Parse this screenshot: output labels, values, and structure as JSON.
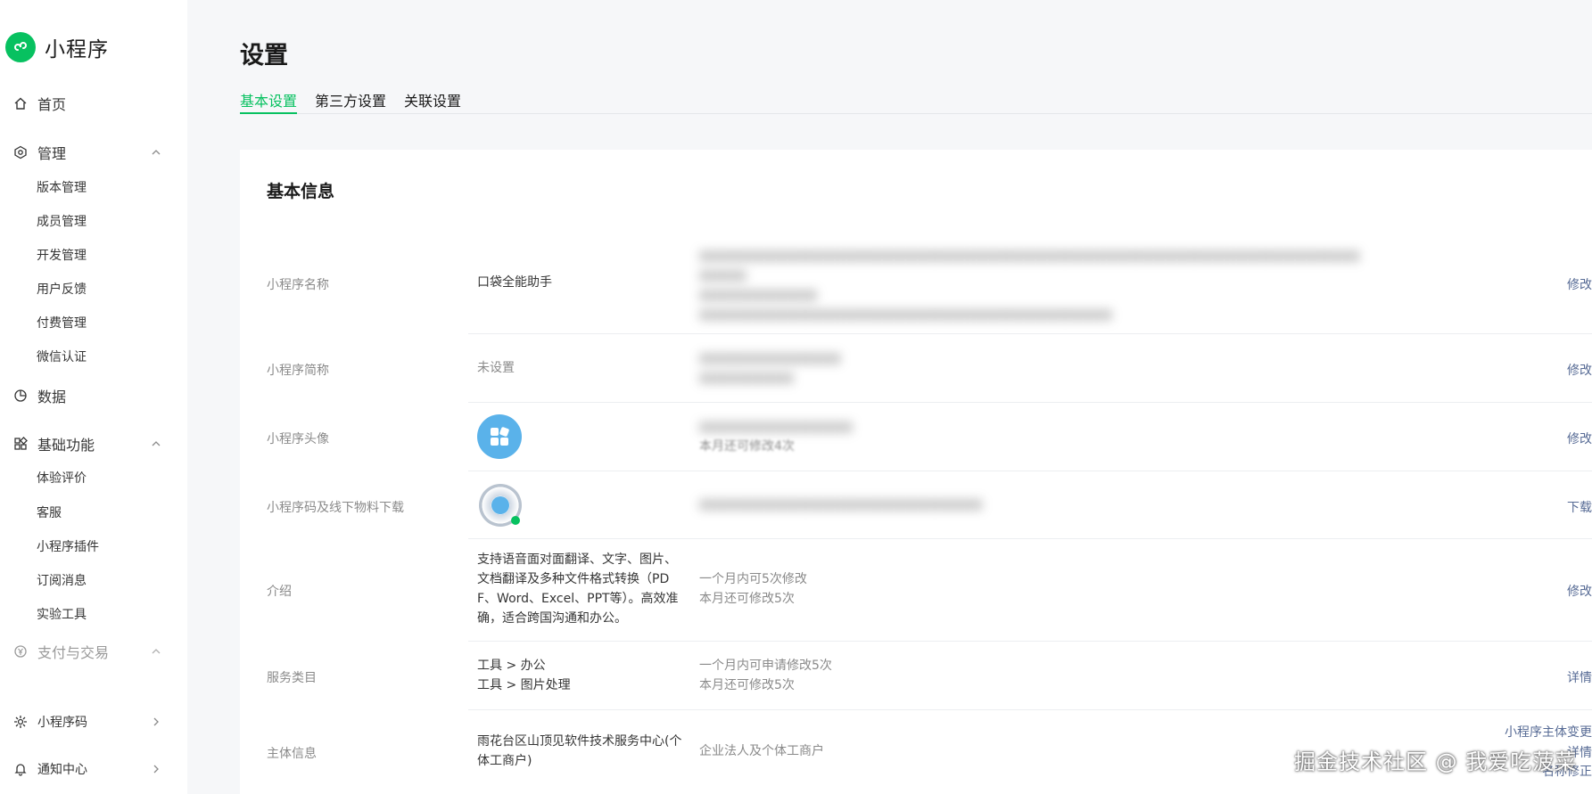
{
  "sidebar": {
    "brand": "小程序",
    "home": "首页",
    "manage": {
      "label": "管理",
      "items": [
        "版本管理",
        "成员管理",
        "开发管理",
        "用户反馈",
        "付费管理",
        "微信认证"
      ]
    },
    "data": "数据",
    "basic": {
      "label": "基础功能",
      "items": [
        "体验评价",
        "客服",
        "小程序插件",
        "订阅消息",
        "实验工具"
      ]
    },
    "payment": "支付与交易",
    "qrcode": "小程序码",
    "notify": "通知中心"
  },
  "header": {
    "title": "设置",
    "tabs": [
      "基本设置",
      "第三方设置",
      "关联设置"
    ]
  },
  "card": {
    "title": "基本信息",
    "rows": {
      "name": {
        "label": "小程序名称",
        "value": "口袋全能助手",
        "action": "修改"
      },
      "short": {
        "label": "小程序简称",
        "value": "未设置",
        "action": "修改"
      },
      "avatar": {
        "label": "小程序头像",
        "desc": "本月还可修改4次",
        "action": "修改"
      },
      "code": {
        "label": "小程序码及线下物料下载",
        "action": "下载"
      },
      "intro": {
        "label": "介绍",
        "value": [
          "支持语音面对面翻译、文字、图片、",
          "文档翻译及多种文件格式转换（PD",
          "F、Word、Excel、PPT等）。高效准",
          "确，适合跨国沟通和办公。"
        ],
        "desc": [
          "一个月内可5次修改",
          "本月还可修改5次"
        ],
        "action": "修改"
      },
      "category": {
        "label": "服务类目",
        "value": [
          "工具 > 办公",
          "工具 > 图片处理"
        ],
        "desc": [
          "一个月内可申请修改5次",
          "本月还可修改5次"
        ],
        "action": "详情"
      },
      "entity": {
        "label": "主体信息",
        "value": [
          "雨花台区山顶见软件技术服务中心(个",
          "体工商户)"
        ],
        "desc": "企业法人及个体工商户",
        "actions": [
          "小程序主体变更",
          "详情",
          "名称修正"
        ]
      }
    }
  },
  "watermark": "掘金技术社区 @ 我爱吃菠菜",
  "colors": {
    "accent": "#07c160",
    "link": "#576b95",
    "avatar": "#5ab2ea"
  }
}
